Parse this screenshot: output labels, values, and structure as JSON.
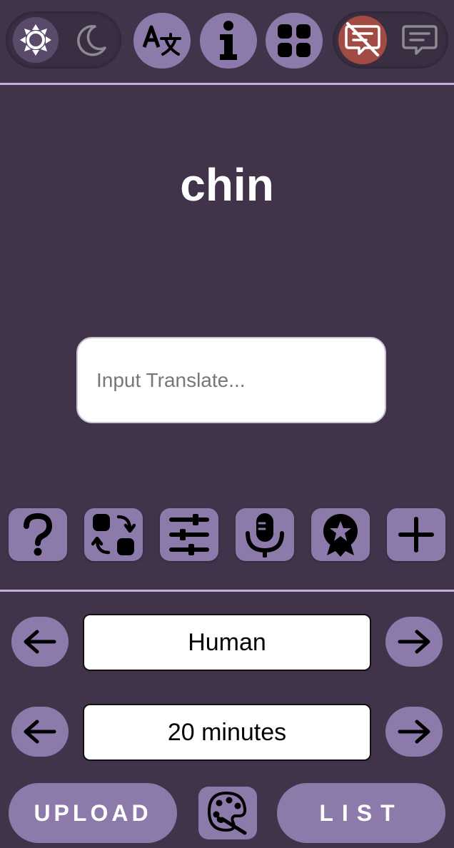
{
  "header": {
    "icons": [
      "sun-icon",
      "moon-icon",
      "translate-icon",
      "info-icon",
      "apps-grid-icon",
      "chat-off-icon",
      "chat-icon"
    ]
  },
  "main": {
    "word": "chin",
    "input_placeholder": "Input Translate..."
  },
  "toolbar": {
    "icons": [
      "help-icon",
      "swap-icon",
      "sliders-icon",
      "microphone-icon",
      "badge-icon",
      "plus-icon"
    ]
  },
  "selectors": {
    "category": "Human",
    "duration": "20 minutes"
  },
  "footer": {
    "upload_label": "UPLOAD",
    "list_label": "LIST",
    "palette_icon": "palette-icon"
  },
  "colors": {
    "background": "#41334a",
    "button": "#8c7aab",
    "divider": "#c4aee0",
    "chat_off": "#a24b45"
  }
}
